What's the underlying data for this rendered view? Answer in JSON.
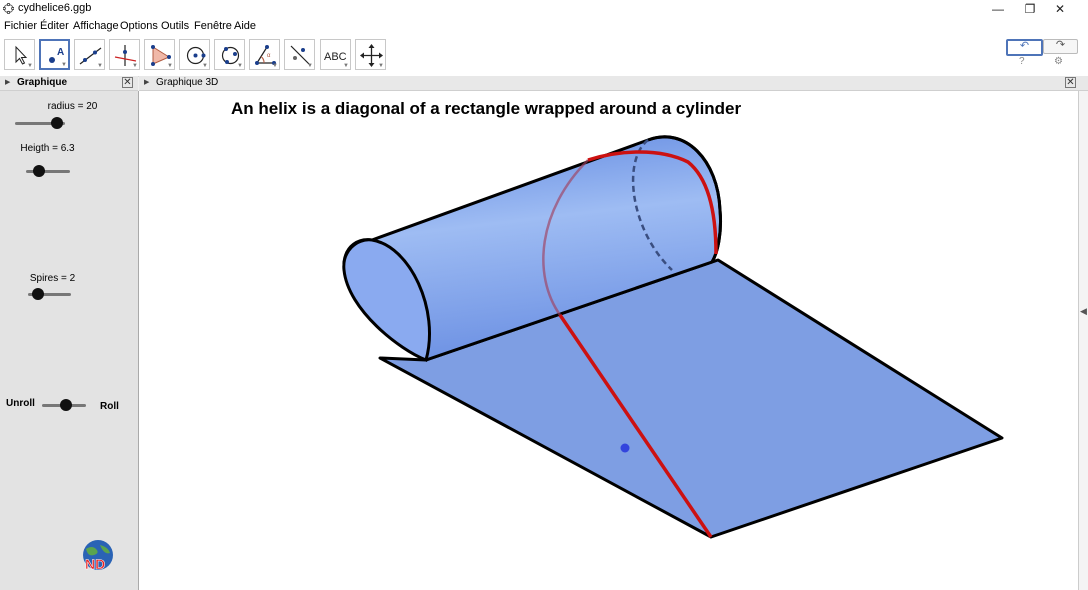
{
  "window": {
    "title": "cydhelice6.ggb",
    "minimize": "—",
    "restore": "❐",
    "close": "✕"
  },
  "menu": [
    "Fichier",
    "Éditer",
    "Affichage",
    "Options",
    "Outils",
    "Fenêtre",
    "Aide"
  ],
  "toolbar": {
    "tools": [
      {
        "name": "move-tool",
        "icon": "arrow-pointer"
      },
      {
        "name": "point-tool",
        "icon": "point-a",
        "active": true
      },
      {
        "name": "line-tool",
        "icon": "line-two-points"
      },
      {
        "name": "perpendicular-tool",
        "icon": "perpendicular-line"
      },
      {
        "name": "polygon-tool",
        "icon": "triangle"
      },
      {
        "name": "circle-tool",
        "icon": "circle-center"
      },
      {
        "name": "circle-three-points-tool",
        "icon": "circle-three-points"
      },
      {
        "name": "angle-tool",
        "icon": "angle"
      },
      {
        "name": "reflect-tool",
        "icon": "reflect-line"
      },
      {
        "name": "text-tool",
        "icon": "text-abc",
        "label": "ABC"
      },
      {
        "name": "move-view-tool",
        "icon": "move-cross"
      }
    ],
    "undo": "↶",
    "redo": "↷",
    "help_icon": "?",
    "settings_icon": "⚙"
  },
  "graphique_panel": {
    "title": "Graphique",
    "close": "✕"
  },
  "view3d_panel": {
    "title": "Graphique 3D",
    "close": "✕"
  },
  "sliders": {
    "radius": {
      "label": "radius = 20",
      "value": 20
    },
    "height": {
      "label": "Heigth = 6.3",
      "value": 6.3
    },
    "spires": {
      "label": "Spires = 2",
      "value": 2
    },
    "roll": {
      "left_label": "Unroll",
      "right_label": "Roll"
    }
  },
  "heading": "An helix is a diagonal of a rectangle wrapped around a cylinder",
  "logo_text": "ND",
  "colors": {
    "surface": "#7e9ee3",
    "helix": "#cc1111",
    "outline": "#000000",
    "point": "#3344dd"
  }
}
